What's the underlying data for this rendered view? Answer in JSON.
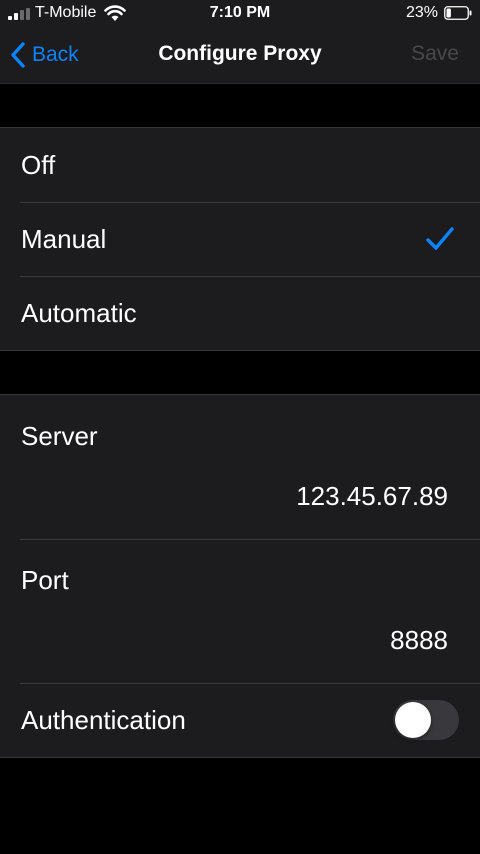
{
  "status_bar": {
    "carrier": "T-Mobile",
    "time": "7:10 PM",
    "battery_percent": "23%",
    "battery_level": 0.23
  },
  "nav": {
    "back_label": "Back",
    "title": "Configure Proxy",
    "save_label": "Save"
  },
  "proxy_modes": [
    {
      "label": "Off",
      "selected": false
    },
    {
      "label": "Manual",
      "selected": true
    },
    {
      "label": "Automatic",
      "selected": false
    }
  ],
  "server": {
    "label": "Server",
    "value": "123.45.67.89"
  },
  "port": {
    "label": "Port",
    "value": "8888"
  },
  "authentication": {
    "label": "Authentication",
    "enabled": false
  },
  "colors": {
    "accent": "#0a84ff",
    "group_background": "#1c1c1e",
    "page_background": "#000000",
    "disabled_text": "#48484a"
  }
}
